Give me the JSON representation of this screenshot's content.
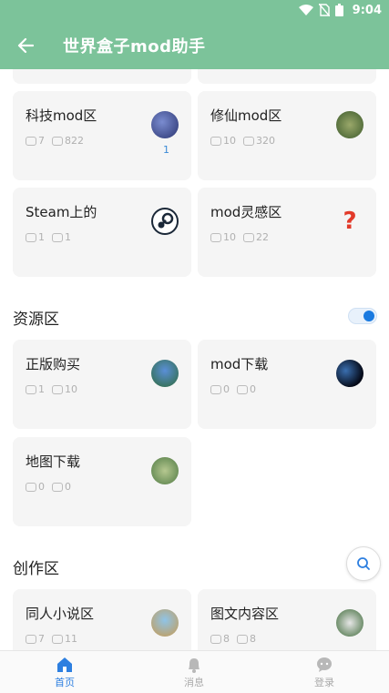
{
  "status_bar": {
    "time": "9:04"
  },
  "app_bar": {
    "title": "世界盒子mod助手"
  },
  "cards_top": [
    {
      "name": "科技mod区",
      "likes": "7",
      "comments": "822",
      "badge": "1"
    },
    {
      "name": "修仙mod区",
      "likes": "10",
      "comments": "320"
    },
    {
      "name": "Steam上的",
      "likes": "1",
      "comments": "1"
    },
    {
      "name": "mod灵感区",
      "likes": "10",
      "comments": "22"
    }
  ],
  "section_resources": {
    "title": "资源区"
  },
  "cards_resources": [
    {
      "name": "正版购买",
      "likes": "1",
      "comments": "10"
    },
    {
      "name": "mod下载",
      "likes": "0",
      "comments": "0"
    },
    {
      "name": "地图下载",
      "likes": "0",
      "comments": "0"
    }
  ],
  "section_creation": {
    "title": "创作区"
  },
  "cards_creation": [
    {
      "name": "同人小说区",
      "likes": "7",
      "comments": "11"
    },
    {
      "name": "图文内容区",
      "likes": "8",
      "comments": "8"
    }
  ],
  "bottom_nav": [
    {
      "label": "首页",
      "active": true
    },
    {
      "label": "消息",
      "active": false
    },
    {
      "label": "登录",
      "active": false
    }
  ],
  "colors": {
    "header": "#7cc39a",
    "accent": "#2d7fe0",
    "card_bg": "#f5f5f5"
  }
}
